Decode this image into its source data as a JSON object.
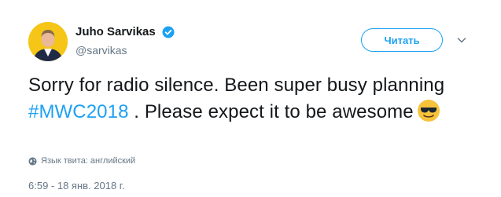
{
  "author": {
    "name": "Juho Sarvikas",
    "handle": "@sarvikas",
    "verified": true,
    "avatar_icon": "profile-photo-icon"
  },
  "follow_button": {
    "label": "Читать"
  },
  "menu": {
    "icon": "chevron-down-icon"
  },
  "tweet": {
    "text_before": "Sorry for radio silence. Been super busy planning ",
    "hashtag": "#MWC2018",
    "text_after": " . Please expect it to be awesome",
    "emoji": "smiling-face-with-sunglasses-icon"
  },
  "language": {
    "label": "Язык твита: английский",
    "icon": "globe-icon"
  },
  "timestamp": "6:59 - 18 янв. 2018 г.",
  "colors": {
    "accent": "#1da1f2",
    "text": "#14171a",
    "secondary": "#657786",
    "avatar_bg": "#f5c518"
  }
}
